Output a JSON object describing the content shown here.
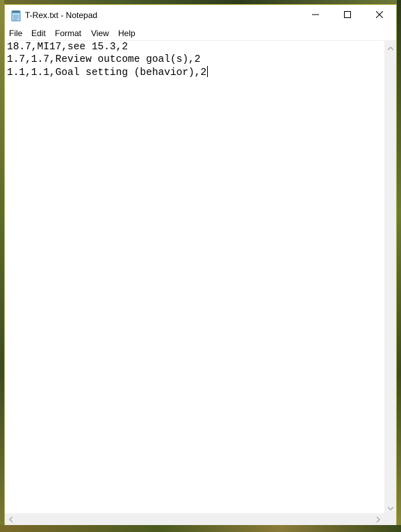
{
  "window": {
    "title": "T-Rex.txt - Notepad",
    "app_icon": "notepad-icon",
    "border_color": "#b8b030"
  },
  "caption_buttons": {
    "minimize_icon": "minimize-icon",
    "maximize_icon": "maximize-icon",
    "close_icon": "close-icon"
  },
  "menu": {
    "file": "File",
    "edit": "Edit",
    "format": "Format",
    "view": "View",
    "help": "Help"
  },
  "editor": {
    "lines": [
      "18.7,MI17,see 15.3,2",
      "1.7,1.7,Review outcome goal(s),2",
      "1.1,1.1,Goal setting (behavior),2"
    ]
  },
  "scrollbars": {
    "up_icon": "chevron-up-icon",
    "down_icon": "chevron-down-icon",
    "left_icon": "chevron-left-icon",
    "right_icon": "chevron-right-icon"
  }
}
